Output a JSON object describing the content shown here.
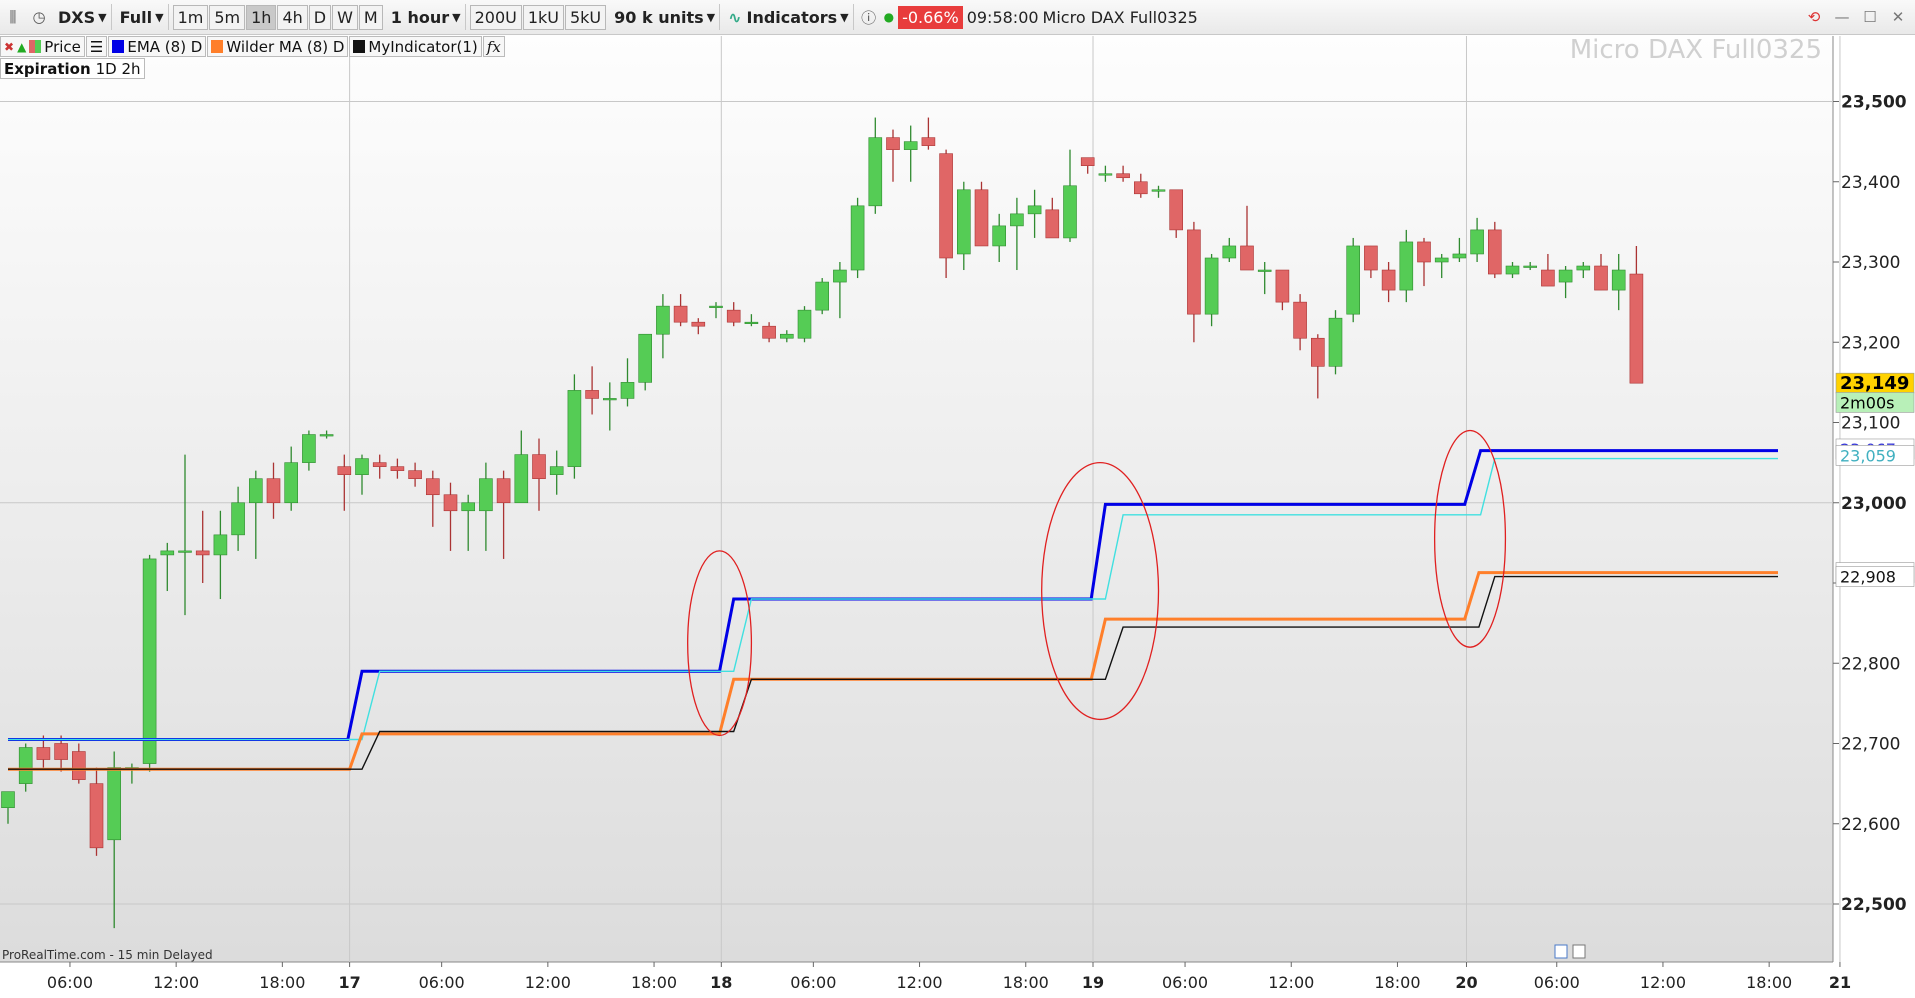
{
  "toolbar": {
    "symbol": "DXS",
    "mode": "Full",
    "intervals": [
      "1m",
      "5m",
      "1h",
      "4h",
      "D",
      "W",
      "M"
    ],
    "selected_interval": "1h",
    "timeframe": "1 hour",
    "bar_counts": [
      "200U",
      "1kU",
      "5kU"
    ],
    "units": "90 k units",
    "indicators_label": "Indicators",
    "change_pct": "-0.66%",
    "time": "09:58:00",
    "instrument": "Micro DAX Full0325"
  },
  "legend": {
    "price_label": "Price",
    "items": [
      {
        "label": "EMA (8) D",
        "color": "#0000e6"
      },
      {
        "label": "Wilder MA (8) D",
        "color": "#ff7f2a"
      },
      {
        "label": "MyIndicator(1)",
        "color": "#111111"
      }
    ]
  },
  "expiration": {
    "label": "Expiration",
    "value": "1D 2h"
  },
  "watermark": "Micro DAX Full0325",
  "footer": "ProRealTime.com - 15 min Delayed",
  "colors": {
    "up": "#55cc55",
    "down": "#e06666",
    "ema": "#0000e6",
    "ema_shadow": "#40e0e0",
    "wilder": "#ff7f2a",
    "myind": "#111111"
  },
  "chart_data": {
    "type": "candlestick",
    "y_axis": {
      "min": 22450,
      "max": 23540,
      "ticks": [
        22500,
        22600,
        22700,
        22800,
        22900,
        23000,
        23100,
        23200,
        23300,
        23400,
        23500
      ],
      "tick_labels": [
        "22,500",
        "22,600",
        "22,700",
        "22,800",
        "",
        "23,000",
        "23,100",
        "23,200",
        "23,300",
        "23,400",
        "23,500"
      ]
    },
    "x_axis": {
      "start_bar": 0,
      "end_bar": 100,
      "labels": [
        {
          "bar": 3.5,
          "text": "06:00",
          "bold": false
        },
        {
          "bar": 9.5,
          "text": "12:00",
          "bold": false
        },
        {
          "bar": 15.5,
          "text": "18:00",
          "bold": false
        },
        {
          "bar": 19.3,
          "text": "17",
          "bold": true
        },
        {
          "bar": 24.5,
          "text": "06:00",
          "bold": false
        },
        {
          "bar": 30.5,
          "text": "12:00",
          "bold": false
        },
        {
          "bar": 36.5,
          "text": "18:00",
          "bold": false
        },
        {
          "bar": 40.3,
          "text": "18",
          "bold": true
        },
        {
          "bar": 45.5,
          "text": "06:00",
          "bold": false
        },
        {
          "bar": 51.5,
          "text": "12:00",
          "bold": false
        },
        {
          "bar": 57.5,
          "text": "18:00",
          "bold": false
        },
        {
          "bar": 61.3,
          "text": "19",
          "bold": true
        },
        {
          "bar": 66.5,
          "text": "06:00",
          "bold": false
        },
        {
          "bar": 72.5,
          "text": "12:00",
          "bold": false
        },
        {
          "bar": 78.5,
          "text": "18:00",
          "bold": false
        },
        {
          "bar": 82.4,
          "text": "20",
          "bold": true
        },
        {
          "bar": 87.5,
          "text": "06:00",
          "bold": false
        },
        {
          "bar": 93.5,
          "text": "12:00",
          "bold": false
        },
        {
          "bar": 99.5,
          "text": "18:00",
          "bold": false
        },
        {
          "bar": 103.5,
          "text": "21",
          "bold": true
        }
      ]
    },
    "candles": [
      [
        22620,
        22640,
        22600,
        22640
      ],
      [
        22650,
        22700,
        22640,
        22695
      ],
      [
        22695,
        22710,
        22670,
        22680
      ],
      [
        22700,
        22710,
        22665,
        22680
      ],
      [
        22690,
        22700,
        22650,
        22655
      ],
      [
        22650,
        22670,
        22560,
        22570
      ],
      [
        22580,
        22690,
        22470,
        22670
      ],
      [
        22670,
        22675,
        22650,
        22670
      ],
      [
        22675,
        22935,
        22665,
        22930
      ],
      [
        22935,
        22950,
        22890,
        22940
      ],
      [
        22940,
        23060,
        22860,
        22940
      ],
      [
        22940,
        22990,
        22900,
        22935
      ],
      [
        22935,
        22990,
        22880,
        22960
      ],
      [
        22960,
        23020,
        22940,
        23000
      ],
      [
        23000,
        23040,
        22930,
        23030
      ],
      [
        23030,
        23050,
        22980,
        23000
      ],
      [
        23000,
        23070,
        22990,
        23050
      ],
      [
        23050,
        23090,
        23040,
        23085
      ],
      [
        23085,
        23090,
        23080,
        23085
      ],
      [
        23045,
        23060,
        22990,
        23035
      ],
      [
        23035,
        23060,
        23010,
        23055
      ],
      [
        23050,
        23060,
        23030,
        23045
      ],
      [
        23045,
        23055,
        23030,
        23040
      ],
      [
        23040,
        23050,
        23020,
        23030
      ],
      [
        23030,
        23040,
        22970,
        23010
      ],
      [
        23010,
        23025,
        22940,
        22990
      ],
      [
        22990,
        23010,
        22940,
        23000
      ],
      [
        22990,
        23050,
        22940,
        23030
      ],
      [
        23030,
        23040,
        22930,
        23000
      ],
      [
        23000,
        23090,
        23000,
        23060
      ],
      [
        23060,
        23080,
        22990,
        23030
      ],
      [
        23035,
        23065,
        23010,
        23045
      ],
      [
        23045,
        23160,
        23030,
        23140
      ],
      [
        23140,
        23170,
        23110,
        23130
      ],
      [
        23130,
        23150,
        23090,
        23130
      ],
      [
        23130,
        23180,
        23120,
        23150
      ],
      [
        23150,
        23210,
        23140,
        23210
      ],
      [
        23210,
        23260,
        23180,
        23245
      ],
      [
        23245,
        23260,
        23220,
        23225
      ],
      [
        23225,
        23230,
        23210,
        23220
      ],
      [
        23245,
        23250,
        23230,
        23245
      ],
      [
        23240,
        23250,
        23220,
        23225
      ],
      [
        23225,
        23235,
        23220,
        23225
      ],
      [
        23220,
        23225,
        23200,
        23205
      ],
      [
        23205,
        23215,
        23200,
        23210
      ],
      [
        23205,
        23245,
        23200,
        23240
      ],
      [
        23240,
        23280,
        23235,
        23275
      ],
      [
        23275,
        23300,
        23230,
        23290
      ],
      [
        23290,
        23380,
        23280,
        23370
      ],
      [
        23370,
        23480,
        23360,
        23455
      ],
      [
        23455,
        23465,
        23400,
        23440
      ],
      [
        23440,
        23470,
        23400,
        23450
      ],
      [
        23455,
        23480,
        23440,
        23445
      ],
      [
        23435,
        23440,
        23280,
        23305
      ],
      [
        23310,
        23400,
        23290,
        23390
      ],
      [
        23390,
        23400,
        23330,
        23320
      ],
      [
        23320,
        23360,
        23300,
        23345
      ],
      [
        23345,
        23380,
        23290,
        23360
      ],
      [
        23360,
        23390,
        23330,
        23370
      ],
      [
        23365,
        23380,
        23335,
        23330
      ],
      [
        23330,
        23440,
        23325,
        23395
      ],
      [
        23430,
        23430,
        23410,
        23420
      ],
      [
        23410,
        23420,
        23400,
        23410
      ],
      [
        23410,
        23420,
        23400,
        23405
      ],
      [
        23400,
        23410,
        23380,
        23385
      ],
      [
        23390,
        23395,
        23380,
        23390
      ],
      [
        23390,
        23390,
        23330,
        23340
      ],
      [
        23340,
        23350,
        23200,
        23235
      ],
      [
        23235,
        23310,
        23220,
        23305
      ],
      [
        23305,
        23330,
        23300,
        23320
      ],
      [
        23320,
        23370,
        23290,
        23290
      ],
      [
        23290,
        23300,
        23260,
        23290
      ],
      [
        23290,
        23290,
        23240,
        23250
      ],
      [
        23250,
        23260,
        23190,
        23205
      ],
      [
        23205,
        23210,
        23130,
        23170
      ],
      [
        23170,
        23240,
        23160,
        23230
      ],
      [
        23235,
        23330,
        23225,
        23320
      ],
      [
        23320,
        23320,
        23280,
        23290
      ],
      [
        23290,
        23300,
        23250,
        23265
      ],
      [
        23265,
        23340,
        23250,
        23325
      ],
      [
        23325,
        23330,
        23270,
        23300
      ],
      [
        23300,
        23310,
        23280,
        23305
      ],
      [
        23305,
        23330,
        23300,
        23310
      ],
      [
        23310,
        23355,
        23300,
        23340
      ],
      [
        23340,
        23350,
        23280,
        23285
      ],
      [
        23285,
        23300,
        23280,
        23295
      ],
      [
        23295,
        23300,
        23290,
        23295
      ],
      [
        23290,
        23310,
        23270,
        23270
      ],
      [
        23275,
        23295,
        23255,
        23290
      ],
      [
        23290,
        23300,
        23280,
        23295
      ],
      [
        23295,
        23310,
        23265,
        23265
      ],
      [
        23265,
        23310,
        23240,
        23290
      ],
      [
        23285,
        23320,
        23150,
        23149
      ]
    ],
    "series": [
      {
        "name": "EMA (8) D",
        "color": "#0000e6",
        "steps": [
          [
            0,
            22705
          ],
          [
            19.2,
            22705
          ],
          [
            20,
            22790
          ],
          [
            40.2,
            22790
          ],
          [
            41,
            22880
          ],
          [
            61.2,
            22880
          ],
          [
            62,
            22998
          ],
          [
            82.3,
            22998
          ],
          [
            83.2,
            23065
          ],
          [
            100,
            23065
          ]
        ]
      },
      {
        "name": "",
        "color": "#40e0e0",
        "steps": [
          [
            0,
            22705
          ],
          [
            20,
            22705
          ],
          [
            21,
            22790
          ],
          [
            41,
            22790
          ],
          [
            42,
            22880
          ],
          [
            62,
            22880
          ],
          [
            63,
            22985
          ],
          [
            83.2,
            22985
          ],
          [
            84,
            23055
          ],
          [
            100,
            23055
          ]
        ]
      },
      {
        "name": "Wilder MA (8) D",
        "color": "#ff7f2a",
        "steps": [
          [
            0,
            22668
          ],
          [
            19.3,
            22668
          ],
          [
            20,
            22712
          ],
          [
            40.2,
            22712
          ],
          [
            41,
            22780
          ],
          [
            61.2,
            22780
          ],
          [
            62,
            22855
          ],
          [
            82.3,
            22855
          ],
          [
            83.1,
            22913
          ],
          [
            100,
            22913
          ]
        ]
      },
      {
        "name": "MyIndicator(1)",
        "color": "#111111",
        "steps": [
          [
            0,
            22668
          ],
          [
            20,
            22668
          ],
          [
            21,
            22715
          ],
          [
            41,
            22715
          ],
          [
            42,
            22780
          ],
          [
            62,
            22780
          ],
          [
            63,
            22845
          ],
          [
            83.1,
            22845
          ],
          [
            84,
            22908
          ],
          [
            100,
            22908
          ]
        ]
      }
    ],
    "price_badges": [
      {
        "value": 23149,
        "text": "23,149",
        "bg": "#ffd200",
        "fg": "#000000",
        "bold": true
      },
      {
        "value": 23125,
        "text": "2m00s",
        "bg": "#b8f0b8",
        "fg": "#000000",
        "bold": false
      },
      {
        "value": 23067,
        "text": "23,067",
        "bg": "#ffffff",
        "fg": "#3b3bd8",
        "bold": false
      },
      {
        "value": 23059,
        "text": "23,059",
        "bg": "#ffffff",
        "fg": "#40b0c0",
        "bold": false
      },
      {
        "value": 22913,
        "text": "22,913",
        "bg": "#ffffff",
        "fg": "#ff7f2a",
        "bold": false
      },
      {
        "value": 22908,
        "text": "22,908",
        "bg": "#ffffff",
        "fg": "#111111",
        "bold": false
      }
    ],
    "annotations": [
      {
        "type": "ellipse",
        "center": [
          40.2,
          22825
        ],
        "radii": [
          1.8,
          115
        ]
      },
      {
        "type": "ellipse",
        "center": [
          61.7,
          22890
        ],
        "radii": [
          3.3,
          160
        ]
      },
      {
        "type": "ellipse",
        "center": [
          82.6,
          22955
        ],
        "radii": [
          2.0,
          135
        ]
      }
    ]
  }
}
